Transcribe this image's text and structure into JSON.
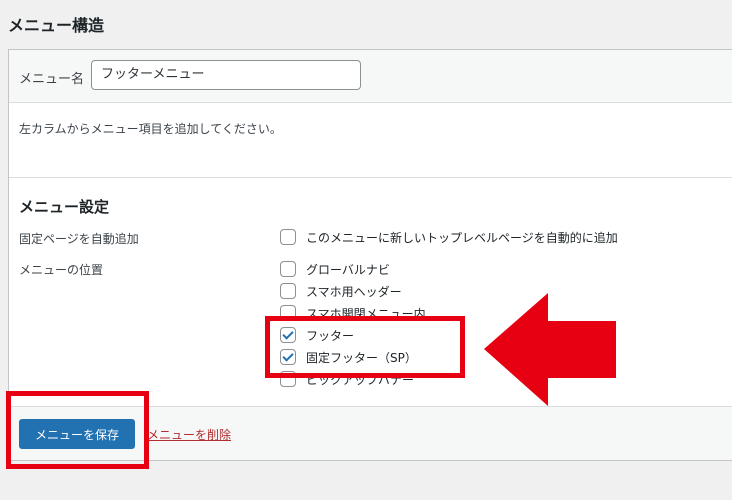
{
  "header": {
    "title": "メニュー構造"
  },
  "menu_name": {
    "label": "メニュー名",
    "value": "フッターメニュー"
  },
  "instruction": "左カラムからメニュー項目を追加してください。",
  "settings": {
    "title": "メニュー設定",
    "auto_add": {
      "label": "固定ページを自動追加",
      "option": {
        "label": "このメニューに新しいトップレベルページを自動的に追加",
        "checked": false
      }
    },
    "locations": {
      "label": "メニューの位置",
      "options": [
        {
          "label": "グローバルナビ",
          "checked": false
        },
        {
          "label": "スマホ用ヘッダー",
          "checked": false
        },
        {
          "label": "スマホ開閉メニュー内",
          "checked": false
        },
        {
          "label": "フッター",
          "checked": true
        },
        {
          "label": "固定フッター（SP）",
          "checked": true
        },
        {
          "label": "ピックアップバナー",
          "checked": false
        }
      ]
    }
  },
  "actions": {
    "save": "メニューを保存",
    "delete": "メニューを削除"
  },
  "colors": {
    "primary": "#2271b1",
    "annotation": "#e60012",
    "delete_link": "#b32d2e"
  }
}
